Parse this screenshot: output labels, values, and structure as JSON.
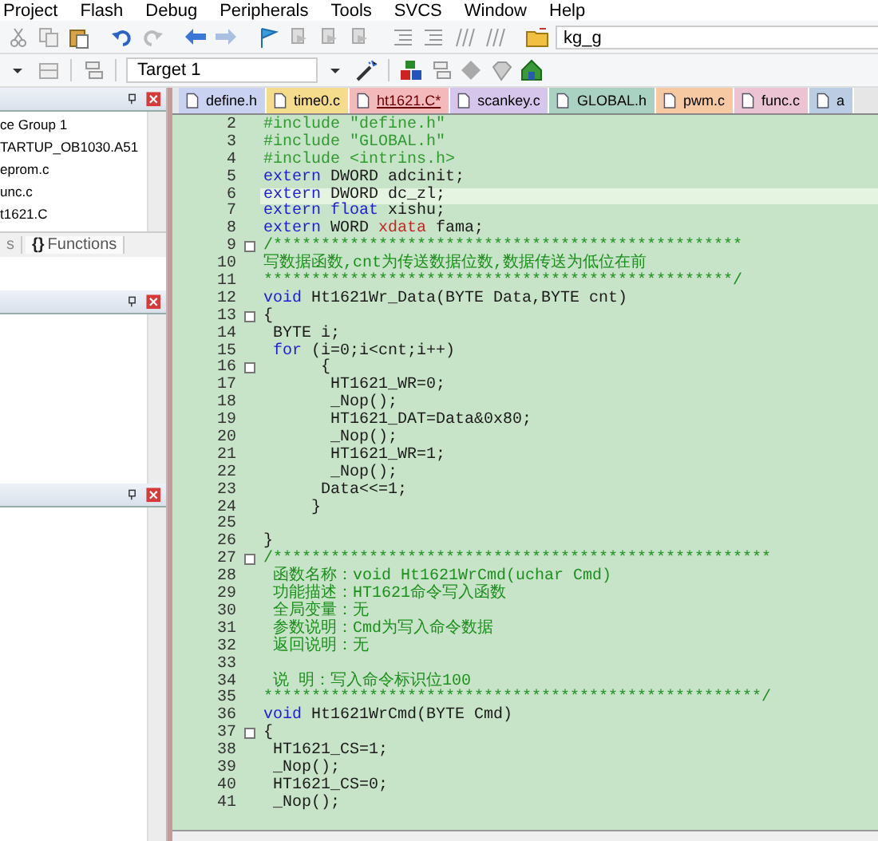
{
  "menu": [
    "Project",
    "Flash",
    "Debug",
    "Peripherals",
    "Tools",
    "SVCS",
    "Window",
    "Help"
  ],
  "toolbar": {
    "find_field": "kg_g",
    "target": "Target 1"
  },
  "project_panel": {
    "items": [
      "ce Group 1",
      "TARTUP_OB1030.A51",
      "eprom.c",
      "unc.c",
      "t1621.C"
    ],
    "tabs": [
      {
        "label": "s",
        "selected": false
      },
      {
        "icon": "{}",
        "label": "Functions",
        "selected": true
      }
    ]
  },
  "tabs": [
    {
      "label": "define.h",
      "color": "#c9d2f0",
      "selected": false
    },
    {
      "label": "time0.c",
      "color": "#f5dc8c",
      "selected": false
    },
    {
      "label": "ht1621.C*",
      "color": "#f4b9ba",
      "selected": true
    },
    {
      "label": "scankey.c",
      "color": "#d6c6ec",
      "selected": false
    },
    {
      "label": "GLOBAL.h",
      "color": "#a9d2c2",
      "selected": false
    },
    {
      "label": "pwm.c",
      "color": "#f6c9a2",
      "selected": false
    },
    {
      "label": "func.c",
      "color": "#ebc3d3",
      "selected": false
    },
    {
      "label": "a",
      "color": "#bacde2",
      "selected": false
    }
  ],
  "code": {
    "lines": [
      {
        "n": "2",
        "foldable": false,
        "current": false,
        "segments": [
          {
            "kind": "pre",
            "text": "#include \"define.h\""
          }
        ]
      },
      {
        "n": "3",
        "foldable": false,
        "current": false,
        "segments": [
          {
            "kind": "pre",
            "text": "#include \"GLOBAL.h\""
          }
        ]
      },
      {
        "n": "4",
        "foldable": false,
        "current": false,
        "segments": [
          {
            "kind": "pre",
            "text": "#include <intrins.h>"
          }
        ]
      },
      {
        "n": "5",
        "foldable": false,
        "current": false,
        "segments": [
          {
            "kind": "kw",
            "text": "extern"
          },
          {
            "kind": "plain",
            "text": " DWORD adcinit;"
          }
        ]
      },
      {
        "n": "6",
        "foldable": false,
        "current": true,
        "segments": [
          {
            "kind": "kw",
            "text": "extern"
          },
          {
            "kind": "plain",
            "text": " DWORD dc_zl;"
          }
        ]
      },
      {
        "n": "7",
        "foldable": false,
        "current": false,
        "segments": [
          {
            "kind": "kw",
            "text": "extern"
          },
          {
            "kind": "kw",
            "text": " float"
          },
          {
            "kind": "plain",
            "text": " xishu;"
          }
        ]
      },
      {
        "n": "8",
        "foldable": false,
        "current": false,
        "segments": [
          {
            "kind": "kw",
            "text": "extern"
          },
          {
            "kind": "plain",
            "text": " WORD "
          },
          {
            "kind": "kw2",
            "text": "xdata"
          },
          {
            "kind": "plain",
            "text": " fama;"
          }
        ]
      },
      {
        "n": "9",
        "foldable": true,
        "current": false,
        "segments": [
          {
            "kind": "comment",
            "text": "/*************************************************"
          }
        ]
      },
      {
        "n": "10",
        "foldable": false,
        "current": false,
        "segments": [
          {
            "kind": "comment",
            "text": "写数据函数,cnt为传送数据位数,数据传送为低位在前"
          }
        ]
      },
      {
        "n": "11",
        "foldable": false,
        "current": false,
        "segments": [
          {
            "kind": "comment",
            "text": "*************************************************/"
          }
        ]
      },
      {
        "n": "12",
        "foldable": false,
        "current": false,
        "segments": [
          {
            "kind": "kw",
            "text": "void"
          },
          {
            "kind": "plain",
            "text": " Ht1621Wr_Data(BYTE Data,BYTE cnt)"
          }
        ]
      },
      {
        "n": "13",
        "foldable": true,
        "current": false,
        "segments": [
          {
            "kind": "plain",
            "text": "{"
          }
        ]
      },
      {
        "n": "14",
        "foldable": false,
        "current": false,
        "segments": [
          {
            "kind": "plain",
            "text": " BYTE i;"
          }
        ]
      },
      {
        "n": "15",
        "foldable": false,
        "current": false,
        "segments": [
          {
            "kind": "kw",
            "text": " for"
          },
          {
            "kind": "plain",
            "text": " (i=0;i<cnt;i++)"
          }
        ]
      },
      {
        "n": "16",
        "foldable": true,
        "current": false,
        "segments": [
          {
            "kind": "plain",
            "text": "      {"
          }
        ]
      },
      {
        "n": "17",
        "foldable": false,
        "current": false,
        "segments": [
          {
            "kind": "plain",
            "text": "       HT1621_WR=0;"
          }
        ]
      },
      {
        "n": "18",
        "foldable": false,
        "current": false,
        "segments": [
          {
            "kind": "plain",
            "text": "       _Nop();"
          }
        ]
      },
      {
        "n": "19",
        "foldable": false,
        "current": false,
        "segments": [
          {
            "kind": "plain",
            "text": "       HT1621_DAT=Data&0x80;"
          }
        ]
      },
      {
        "n": "20",
        "foldable": false,
        "current": false,
        "segments": [
          {
            "kind": "plain",
            "text": "       _Nop();"
          }
        ]
      },
      {
        "n": "21",
        "foldable": false,
        "current": false,
        "segments": [
          {
            "kind": "plain",
            "text": "       HT1621_WR=1;"
          }
        ]
      },
      {
        "n": "22",
        "foldable": false,
        "current": false,
        "segments": [
          {
            "kind": "plain",
            "text": "       _Nop();"
          }
        ]
      },
      {
        "n": "23",
        "foldable": false,
        "current": false,
        "segments": [
          {
            "kind": "plain",
            "text": "      Data<<=1;"
          }
        ]
      },
      {
        "n": "24",
        "foldable": false,
        "current": false,
        "segments": [
          {
            "kind": "plain",
            "text": "     }"
          }
        ]
      },
      {
        "n": "25",
        "foldable": false,
        "current": false
      },
      {
        "n": "26",
        "foldable": false,
        "current": false,
        "segments": [
          {
            "kind": "plain",
            "text": "}"
          }
        ]
      },
      {
        "n": "27",
        "foldable": true,
        "current": false,
        "segments": [
          {
            "kind": "comment",
            "text": "/****************************************************"
          }
        ]
      },
      {
        "n": "28",
        "foldable": false,
        "current": false,
        "segments": [
          {
            "kind": "comment",
            "text": " 函数名称：void Ht1621WrCmd(uchar Cmd)"
          }
        ]
      },
      {
        "n": "29",
        "foldable": false,
        "current": false,
        "segments": [
          {
            "kind": "comment",
            "text": " 功能描述：HT1621命令写入函数"
          }
        ]
      },
      {
        "n": "30",
        "foldable": false,
        "current": false,
        "segments": [
          {
            "kind": "comment",
            "text": " 全局变量：无"
          }
        ]
      },
      {
        "n": "31",
        "foldable": false,
        "current": false,
        "segments": [
          {
            "kind": "comment",
            "text": " 参数说明：Cmd为写入命令数据"
          }
        ]
      },
      {
        "n": "32",
        "foldable": false,
        "current": false,
        "segments": [
          {
            "kind": "comment",
            "text": " 返回说明：无"
          }
        ]
      },
      {
        "n": "33",
        "foldable": false,
        "current": false
      },
      {
        "n": "34",
        "foldable": false,
        "current": false,
        "segments": [
          {
            "kind": "comment",
            "text": " 说 明：写入命令标识位100"
          }
        ]
      },
      {
        "n": "35",
        "foldable": false,
        "current": false,
        "segments": [
          {
            "kind": "comment",
            "text": "****************************************************/"
          }
        ]
      },
      {
        "n": "36",
        "foldable": false,
        "current": false,
        "segments": [
          {
            "kind": "kw",
            "text": "void"
          },
          {
            "kind": "plain",
            "text": " Ht1621WrCmd(BYTE Cmd)"
          }
        ]
      },
      {
        "n": "37",
        "foldable": true,
        "current": false,
        "segments": [
          {
            "kind": "plain",
            "text": "{"
          }
        ]
      },
      {
        "n": "38",
        "foldable": false,
        "current": false,
        "segments": [
          {
            "kind": "plain",
            "text": " HT1621_CS=1;"
          }
        ]
      },
      {
        "n": "39",
        "foldable": false,
        "current": false,
        "segments": [
          {
            "kind": "plain",
            "text": " _Nop();"
          }
        ]
      },
      {
        "n": "40",
        "foldable": false,
        "current": false,
        "segments": [
          {
            "kind": "plain",
            "text": " HT1621_CS=0;"
          }
        ]
      },
      {
        "n": "41",
        "foldable": false,
        "current": false,
        "segments": [
          {
            "kind": "plain",
            "text": " _Nop();"
          }
        ]
      }
    ]
  }
}
